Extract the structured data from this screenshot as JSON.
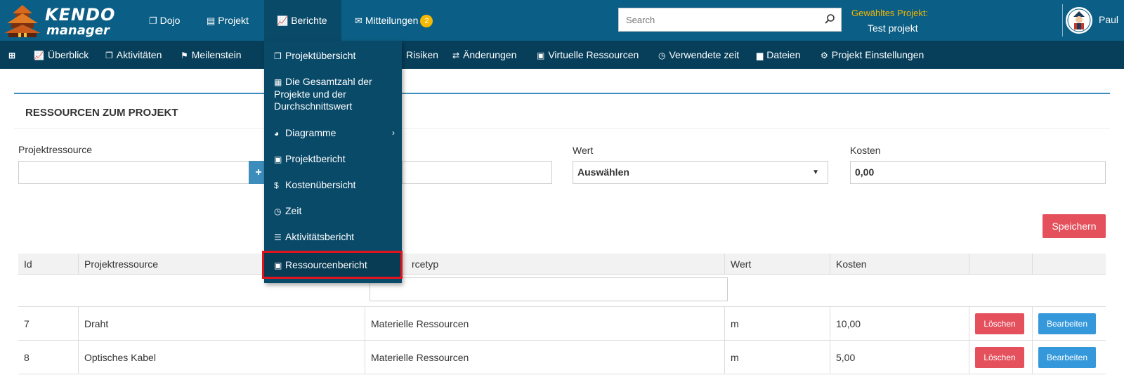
{
  "app": {
    "logo_line1": "KENDO",
    "logo_line2": "manager"
  },
  "topnav": {
    "items": [
      {
        "label": "Dojo",
        "icon": "copy-icon"
      },
      {
        "label": "Projekt",
        "icon": "file-icon"
      },
      {
        "label": "Berichte",
        "icon": "line-chart-icon"
      },
      {
        "label": "Mitteilungen",
        "icon": "envelope-icon",
        "badge": "2"
      }
    ],
    "search_placeholder": "Search",
    "selected_project_label": "Gewähltes Projekt:",
    "selected_project_name": "Test projekt",
    "user_name": "Paul"
  },
  "subnav": {
    "items": [
      {
        "label": "",
        "icon": "plus-square-icon"
      },
      {
        "label": "Überblick",
        "icon": "line-chart-icon"
      },
      {
        "label": "Aktivitäten",
        "icon": "copy-icon"
      },
      {
        "label": "Meilenstein",
        "icon": "flag-icon"
      },
      {
        "label": "Risiken",
        "icon": ""
      },
      {
        "label": "Änderungen",
        "icon": "exchange-icon"
      },
      {
        "label": "Virtuelle Ressourcen",
        "icon": "briefcase-icon"
      },
      {
        "label": "Verwendete zeit",
        "icon": "clock-icon"
      },
      {
        "label": "Dateien",
        "icon": "folder-icon"
      },
      {
        "label": "Projekt Einstellungen",
        "icon": "cogs-icon"
      }
    ]
  },
  "dropdown": {
    "items": [
      {
        "label": "Projektübersicht",
        "icon": "copy-icon"
      },
      {
        "label": "Die Gesamtzahl der Projekte und der Durchschnittswert",
        "icon": "calculator-icon"
      },
      {
        "label": "Diagramme",
        "icon": "pie-chart-icon"
      },
      {
        "label": "Projektbericht",
        "icon": "briefcase-icon"
      },
      {
        "label": "Kostenübersicht",
        "icon": "dollar-icon"
      },
      {
        "label": "Zeit",
        "icon": "clock-icon"
      },
      {
        "label": "Aktivitätsbericht",
        "icon": "list-icon"
      },
      {
        "label": "Ressourcenbericht",
        "icon": "briefcase-icon"
      }
    ],
    "highlighted": "Ressourcenbericht",
    "highlight_color": "#e0141e"
  },
  "card": {
    "title": "RESSOURCEN ZUM PROJEKT",
    "accent_color": "#3c8dbc"
  },
  "form": {
    "resource_label": "Projektressource",
    "resource_value": "",
    "add_label": "+",
    "value_label": "Wert",
    "value_selected": "Auswählen",
    "cost_label": "Kosten",
    "cost_value": "0,00",
    "save_label": "Speichern"
  },
  "table": {
    "headers": [
      "Id",
      "Projektressource",
      "Ressourcetyp",
      "Wert",
      "Kosten",
      "",
      ""
    ],
    "header_resourcetype_visible": "rcetyp",
    "rows": [
      {
        "id": "7",
        "resource": "Draht",
        "type": "Materielle Ressourcen",
        "unit": "m",
        "cost": "10,00"
      },
      {
        "id": "8",
        "resource": "Optisches Kabel",
        "type": "Materielle Ressourcen",
        "unit": "m",
        "cost": "5,00"
      }
    ],
    "delete_label": "Löschen",
    "edit_label": "Bearbeiten"
  },
  "colors": {
    "topbar": "#0b5e85",
    "subnav": "#073f5a",
    "danger": "#e5505d",
    "primary": "#3498db",
    "badge": "#f6b800"
  }
}
